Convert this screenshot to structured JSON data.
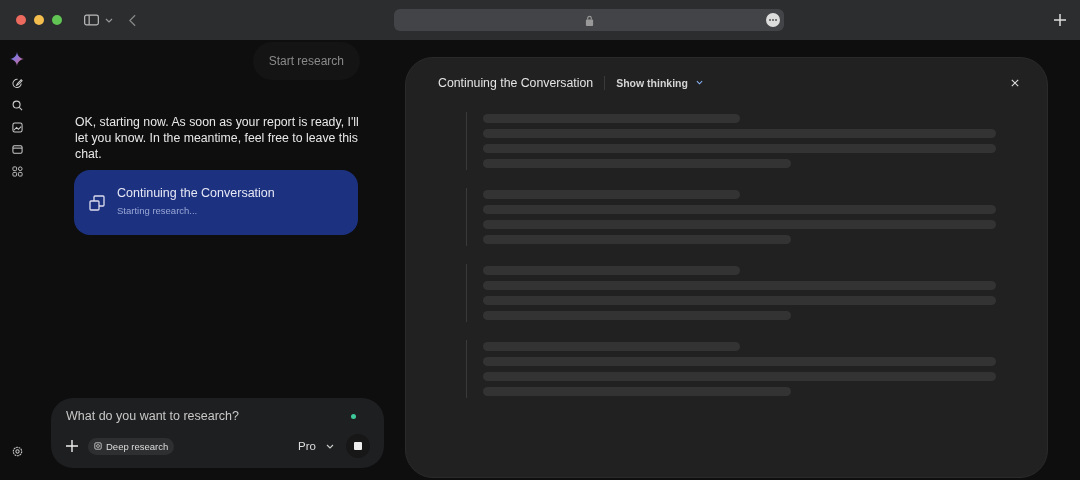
{
  "chat": {
    "start_research_button": "Start research",
    "message": "OK, starting now. As soon as your report is ready, I'll let you know. In the meantime, feel free to leave this chat.",
    "research_card": {
      "title": "Continuing the Conversation",
      "status": "Starting research..."
    }
  },
  "composer": {
    "placeholder": "What do you want to research?",
    "tool_chip": "Deep research",
    "model": "Pro"
  },
  "panel": {
    "title": "Continuing the Conversation",
    "toggle": "Show thinking",
    "expanded": false
  }
}
